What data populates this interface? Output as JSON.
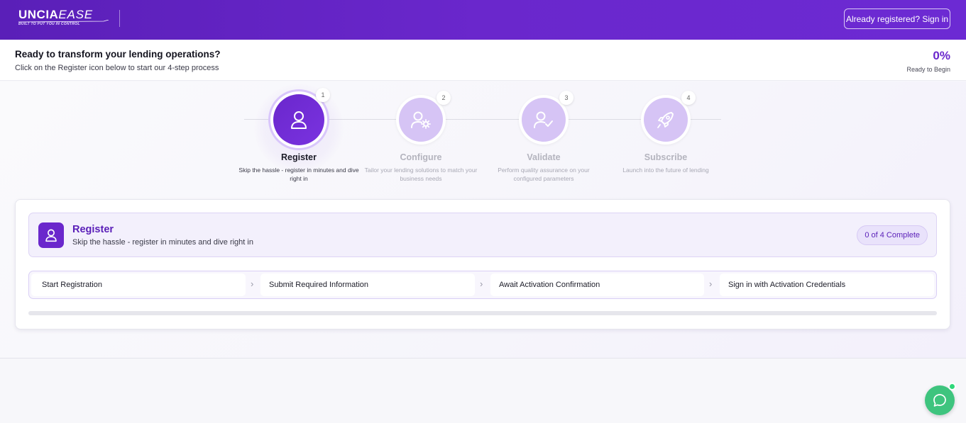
{
  "header": {
    "logo_main": "UNCIA",
    "logo_accent": "EASE",
    "logo_tagline": "BUILT TO PUT YOU IN CONTROL",
    "signin_label": "Already registered? Sign in"
  },
  "intro": {
    "title": "Ready to transform your lending operations?",
    "subtitle": "Click on the Register icon below to start our 4-step process",
    "progress_value": "0%",
    "progress_label": "Ready to Begin"
  },
  "steps": [
    {
      "number": "1",
      "title": "Register",
      "description": "Skip the hassle - register in minutes and dive right in",
      "icon": "user-icon",
      "active": true
    },
    {
      "number": "2",
      "title": "Configure",
      "description": "Tailor your lending solutions to match your business needs",
      "icon": "user-gear-icon",
      "active": false
    },
    {
      "number": "3",
      "title": "Validate",
      "description": "Perform quality assurance on your configured parameters",
      "icon": "user-check-icon",
      "active": false
    },
    {
      "number": "4",
      "title": "Subscribe",
      "description": "Launch into the future of lending",
      "icon": "rocket-icon",
      "active": false
    }
  ],
  "card": {
    "title": "Register",
    "subtitle": "Skip the hassle - register in minutes and dive right in",
    "badge": "0 of 4 Complete",
    "substeps": [
      "Start Registration",
      "Submit Required Information",
      "Await Activation Confirmation",
      "Sign in with Activation Credentials"
    ],
    "progress_fraction": 0
  },
  "colors": {
    "brand": "#6a27cc",
    "chat": "#3ec47e"
  }
}
